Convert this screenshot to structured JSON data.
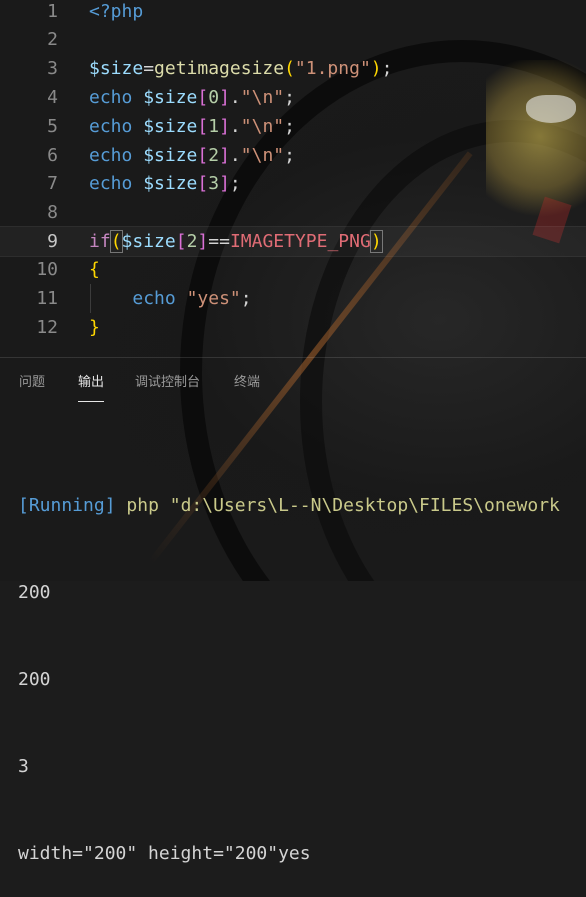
{
  "editor": {
    "line_numbers": [
      "1",
      "2",
      "3",
      "4",
      "5",
      "6",
      "7",
      "8",
      "9",
      "10",
      "11",
      "12"
    ],
    "active_line": "9",
    "tokens": {
      "php_open": "<?php",
      "var_size": "$size",
      "eq": "=",
      "fn_getimagesize": "getimagesize",
      "str_file": "\"1.png\"",
      "semicolon": ";",
      "kw_echo": "echo",
      "idx0": "0",
      "idx1": "1",
      "idx2": "2",
      "idx3": "3",
      "dot": ".",
      "str_newline": "\"\\n\"",
      "kw_if": "if",
      "op_eqeq": "==",
      "const_png": "IMAGETYPE_PNG",
      "brace_open": "{",
      "brace_close": "}",
      "str_yes": "\"yes\""
    }
  },
  "panel": {
    "tabs": [
      {
        "label": "问题"
      },
      {
        "label": "输出"
      },
      {
        "label": "调试控制台"
      },
      {
        "label": "终端"
      }
    ],
    "active_tab": "输出"
  },
  "output": {
    "running_tag": "[Running]",
    "command": "php \"d:\\Users\\L--N\\Desktop\\FILES\\onework",
    "lines": [
      "200",
      "200",
      "3",
      "width=\"200\" height=\"200\"yes"
    ]
  },
  "colors": {
    "keyword": "#569cd6",
    "control": "#c586c0",
    "variable": "#9cdcfe",
    "function": "#dcdcaa",
    "string": "#ce9178",
    "number": "#b5cea8",
    "constant": "#e06c75"
  }
}
